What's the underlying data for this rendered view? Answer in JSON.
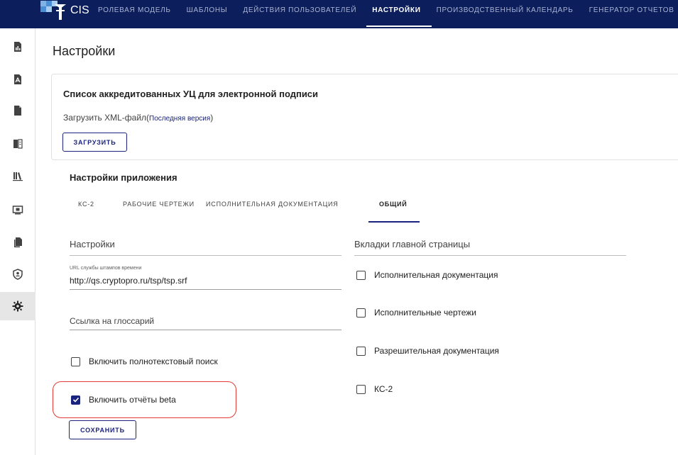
{
  "app": {
    "name": "CIS"
  },
  "nav": {
    "items": [
      {
        "label": "Ролевая модель"
      },
      {
        "label": "Шаблоны"
      },
      {
        "label": "Действия пользователей"
      },
      {
        "label": "Настройки"
      },
      {
        "label": "Производственный календарь"
      },
      {
        "label": "Генератор отчетов"
      }
    ],
    "active": "Настройки"
  },
  "sidebar": {
    "items": [
      {
        "icon": "report-document-icon"
      },
      {
        "icon": "signed-document-icon"
      },
      {
        "icon": "document-icon"
      },
      {
        "icon": "documents-compare-icon"
      },
      {
        "icon": "library-icon"
      },
      {
        "icon": "monitor-icon"
      },
      {
        "icon": "file-copy-icon"
      },
      {
        "icon": "shield-user-icon"
      },
      {
        "icon": "gear-icon",
        "active": true
      }
    ]
  },
  "page": {
    "title": "Настройки"
  },
  "ca_card": {
    "title": "Список аккредитованных УЦ для электронной подписи",
    "upload_text": "Загрузить XML-файл(",
    "upload_link": "Последняя версия",
    "upload_text_end": ")",
    "upload_button": "Загрузить"
  },
  "app_settings": {
    "title": "Настройки приложения",
    "tabs": [
      {
        "label": "КС-2"
      },
      {
        "label": "Рабочие чертежи"
      },
      {
        "label": "Исполнительная документация"
      },
      {
        "label": "Общий",
        "active": true
      }
    ],
    "left": {
      "header": "Настройки",
      "timestamp_field": {
        "label": "URL службы штампов времени",
        "value": "http://qs.cryptopro.ru/tsp/tsp.srf"
      },
      "glossary_field": {
        "placeholder": "Ссылка на глоссарий"
      },
      "fulltext_search": {
        "label": "Включить полнотекстовый поиск",
        "checked": false
      },
      "reports_beta": {
        "label": "Включить отчёты beta",
        "checked": true
      },
      "save_button": "Сохранить"
    },
    "right": {
      "header": "Вкладки главной страницы",
      "tabs": [
        {
          "label": "Исполнительная документация",
          "checked": false
        },
        {
          "label": "Исполнительные чертежи",
          "checked": false
        },
        {
          "label": "Разрешительная документация",
          "checked": false
        },
        {
          "label": "КС-2",
          "checked": false
        }
      ]
    }
  },
  "colors": {
    "topbar": "#0c1f5c",
    "accent": "#1a237e",
    "highlight": "#e53935"
  }
}
